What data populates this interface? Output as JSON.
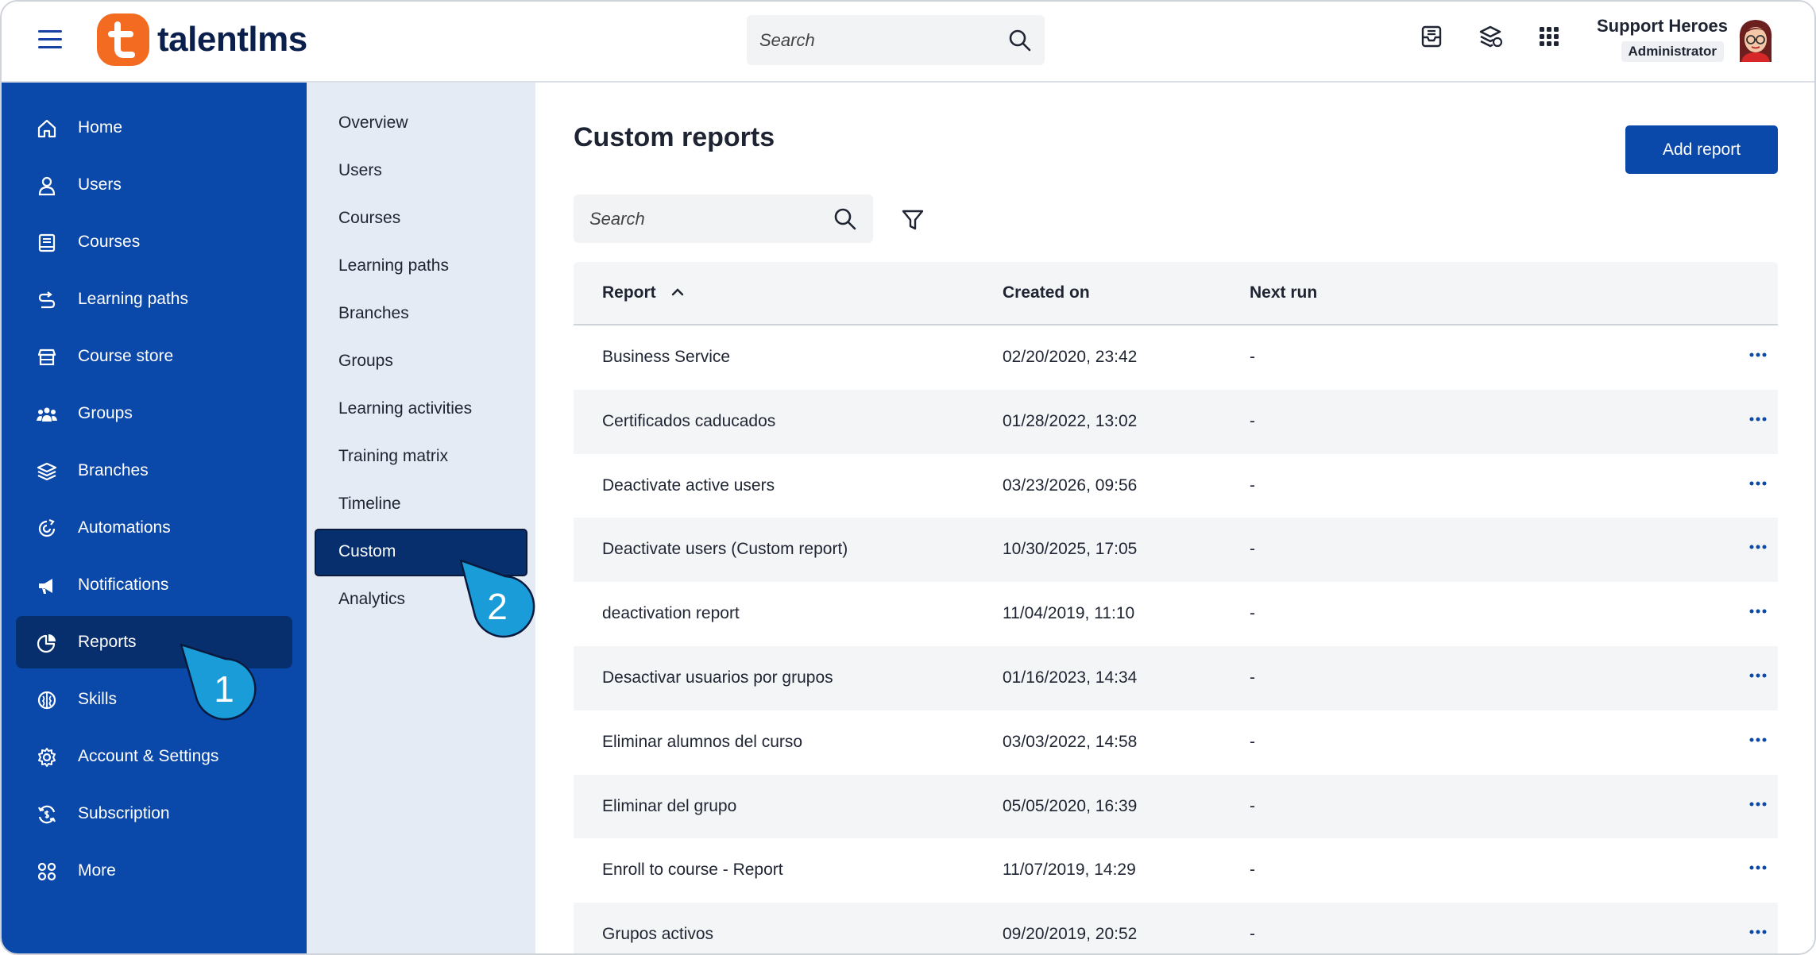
{
  "header": {
    "brand": "talentlms",
    "search_placeholder": "Search",
    "icons": [
      "inbox-icon",
      "coins-icon",
      "apps-grid-icon"
    ],
    "user_name": "Support Heroes",
    "user_role": "Administrator"
  },
  "sidebar": {
    "items": [
      {
        "label": "Home",
        "icon": "home-icon"
      },
      {
        "label": "Users",
        "icon": "user-icon"
      },
      {
        "label": "Courses",
        "icon": "book-icon"
      },
      {
        "label": "Learning paths",
        "icon": "path-icon"
      },
      {
        "label": "Course store",
        "icon": "store-icon"
      },
      {
        "label": "Groups",
        "icon": "groups-icon"
      },
      {
        "label": "Branches",
        "icon": "layers-icon"
      },
      {
        "label": "Automations",
        "icon": "automation-icon"
      },
      {
        "label": "Notifications",
        "icon": "megaphone-icon"
      },
      {
        "label": "Reports",
        "icon": "pie-chart-icon",
        "active": true
      },
      {
        "label": "Skills",
        "icon": "brain-icon"
      },
      {
        "label": "Account & Settings",
        "icon": "gear-icon"
      },
      {
        "label": "Subscription",
        "icon": "refresh-dollar-icon"
      },
      {
        "label": "More",
        "icon": "grid-dots-icon"
      }
    ]
  },
  "subnav": {
    "items": [
      {
        "label": "Overview"
      },
      {
        "label": "Users"
      },
      {
        "label": "Courses"
      },
      {
        "label": "Learning paths"
      },
      {
        "label": "Branches"
      },
      {
        "label": "Groups"
      },
      {
        "label": "Learning activities"
      },
      {
        "label": "Training matrix"
      },
      {
        "label": "Timeline"
      },
      {
        "label": "Custom",
        "active": true
      },
      {
        "label": "Analytics"
      }
    ]
  },
  "main": {
    "title": "Custom reports",
    "add_button": "Add report",
    "search_placeholder": "Search",
    "columns": [
      "Report",
      "Created on",
      "Next run"
    ],
    "rows": [
      {
        "report": "Business Service",
        "created": "02/20/2020, 23:42",
        "next_run": "-"
      },
      {
        "report": "Certificados caducados",
        "created": "01/28/2022, 13:02",
        "next_run": "-"
      },
      {
        "report": "Deactivate active users",
        "created": "03/23/2026, 09:56",
        "next_run": "-"
      },
      {
        "report": "Deactivate users (Custom report)",
        "created": "10/30/2025, 17:05",
        "next_run": "-"
      },
      {
        "report": "deactivation report",
        "created": "11/04/2019, 11:10",
        "next_run": "-"
      },
      {
        "report": "Desactivar usuarios por grupos",
        "created": "01/16/2023, 14:34",
        "next_run": "-"
      },
      {
        "report": "Eliminar alumnos del curso",
        "created": "03/03/2022, 14:58",
        "next_run": "-"
      },
      {
        "report": "Eliminar del grupo",
        "created": "05/05/2020, 16:39",
        "next_run": "-"
      },
      {
        "report": "Enroll to course - Report",
        "created": "11/07/2019, 14:29",
        "next_run": "-"
      },
      {
        "report": "Grupos activos",
        "created": "09/20/2019, 20:52",
        "next_run": "-"
      }
    ]
  },
  "callouts": {
    "first": "1",
    "second": "2"
  },
  "colors": {
    "sidebar": "#0a48aa",
    "sidebar_active": "#072f6e",
    "subnav": "#e4ebf5",
    "brand_orange": "#f36b21",
    "button": "#0a48aa",
    "callout": "#1a9cd8"
  }
}
